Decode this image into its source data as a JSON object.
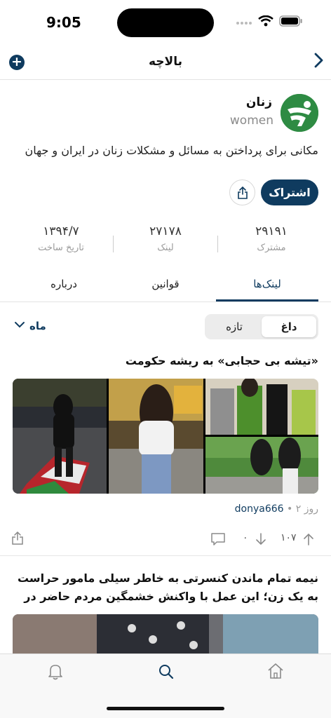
{
  "status": {
    "time": "9:05"
  },
  "nav": {
    "title": "بالاچه",
    "add_icon": "plus-circle-icon",
    "back_icon": "chevron-right-icon"
  },
  "community": {
    "name": "زنان",
    "name_en": "women",
    "description": "مکانی برای پرداختن به مسائل و مشکلات زنان در ایران و جهان",
    "join_label": "اشتراک",
    "logo_color": "#2e8b43"
  },
  "stats": [
    {
      "value": "۲۹۱۹۱",
      "label": "مشترک"
    },
    {
      "value": "۲۷۱۷۸",
      "label": "لینک"
    },
    {
      "value": "۱۳۹۴/۷",
      "label": "تاریخ ساخت"
    }
  ],
  "tabs": [
    {
      "label": "لینک‌ها",
      "active": true
    },
    {
      "label": "قوانین",
      "active": false
    },
    {
      "label": "درباره",
      "active": false
    }
  ],
  "sort": {
    "segments": [
      {
        "label": "داغ",
        "active": true
      },
      {
        "label": "تازه",
        "active": false
      }
    ],
    "period": "ماه"
  },
  "posts": [
    {
      "title": "«تیشه بی حجابی» به ریشه حکومت",
      "user": "donya666",
      "age": "• ۲ روز",
      "upvotes": "۱۰۷",
      "comments": "۰"
    },
    {
      "title": "نیمه تمام ماندن کنسرتی به خاطر سیلی مامور حراست به یک زن؛ این عمل با واکنش خشمگین مردم حاضر در ..."
    }
  ],
  "tabbar": {
    "items": [
      "bell-icon",
      "search-icon",
      "home-icon"
    ]
  },
  "colors": {
    "accent": "#0f3b5f",
    "muted": "#9b9b9b"
  }
}
